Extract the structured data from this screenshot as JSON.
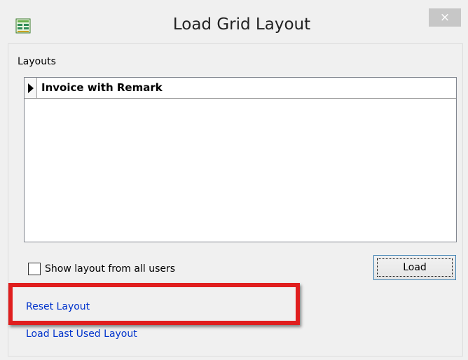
{
  "window": {
    "title": "Load Grid Layout",
    "close_symbol": "×",
    "app_icon": "grid-app-icon"
  },
  "layouts": {
    "label": "Layouts",
    "rows": [
      {
        "name": "Invoice with Remark",
        "selected": true
      }
    ]
  },
  "options": {
    "show_all_users_label": "Show layout from all users",
    "show_all_users_checked": false
  },
  "buttons": {
    "load_label": "Load"
  },
  "links": {
    "reset_label": "Reset Layout",
    "load_last_label": "Load Last Used Layout"
  },
  "colors": {
    "link": "#0033cc",
    "highlight": "#e01e1e",
    "close_button": "#c7c7c7"
  }
}
